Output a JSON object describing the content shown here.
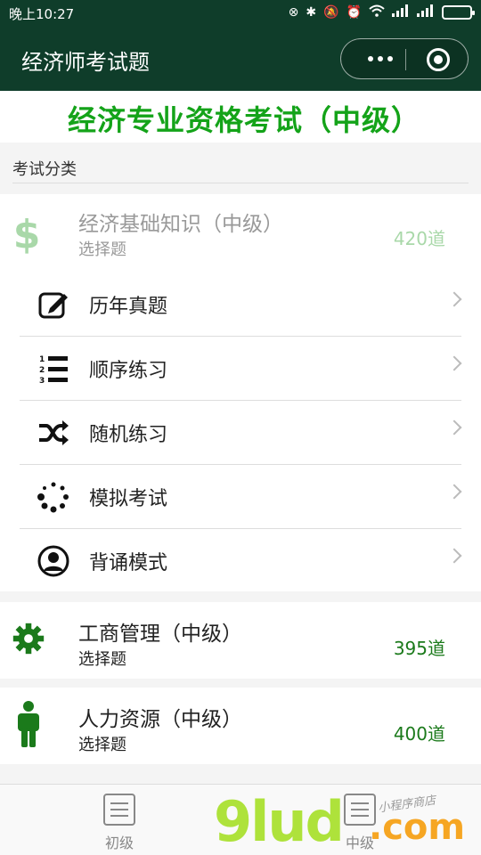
{
  "status": {
    "time": "晚上10:27",
    "icons": [
      "link-icon",
      "bluetooth-icon",
      "mute-icon",
      "alarm-icon",
      "wifi-icon",
      "signal-icon",
      "signal-icon",
      "battery-icon"
    ]
  },
  "navbar": {
    "title": "经济师考试题"
  },
  "banner": {
    "title": "经济专业资格考试（中级）"
  },
  "section": {
    "label": "考试分类"
  },
  "categories": [
    {
      "name": "经济基础知识（中级）",
      "sub": "选择题",
      "count": "420道",
      "icon": "dollar-icon",
      "color": "#a9d8a9",
      "expanded": true,
      "items": [
        {
          "label": "历年真题",
          "icon": "edit-icon"
        },
        {
          "label": "顺序练习",
          "icon": "ordered-list-icon"
        },
        {
          "label": "随机练习",
          "icon": "shuffle-icon"
        },
        {
          "label": "模拟考试",
          "icon": "spinner-icon"
        },
        {
          "label": "背诵模式",
          "icon": "user-circle-icon"
        }
      ]
    },
    {
      "name": "工商管理（中级）",
      "sub": "选择题",
      "count": "395道",
      "icon": "gear-icon",
      "color": "#1b7a1b"
    },
    {
      "name": "人力资源（中级）",
      "sub": "选择题",
      "count": "400道",
      "icon": "person-icon",
      "color": "#1b7a1b"
    }
  ],
  "tabs": [
    {
      "label": "初级",
      "icon": "list-icon"
    },
    {
      "label": "中级",
      "icon": "list-icon"
    }
  ],
  "watermark": {
    "big": "9lud",
    "com": ".com",
    "small": "小程序商店"
  },
  "colors": {
    "header_bg": "#0f3d2a",
    "banner_text": "#14a319",
    "accent_green": "#1b7a1b",
    "faded_green": "#a9d8a9"
  }
}
